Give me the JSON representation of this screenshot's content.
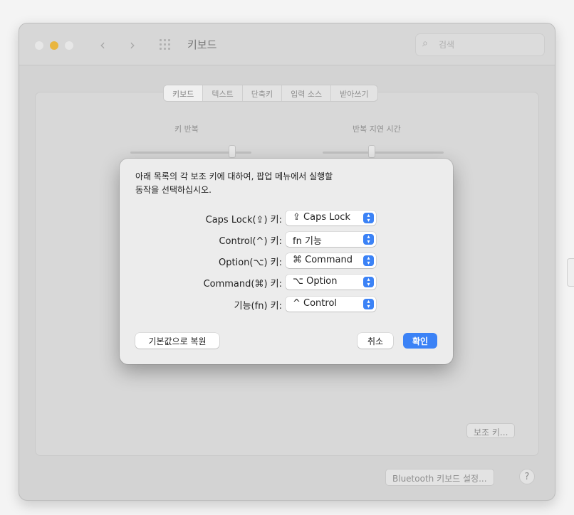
{
  "window": {
    "title": "키보드",
    "search_placeholder": "검색",
    "nav_back": "‹",
    "nav_forward": "›"
  },
  "tabs": [
    {
      "label": "키보드",
      "active": true
    },
    {
      "label": "텍스트",
      "active": false
    },
    {
      "label": "단축키",
      "active": false
    },
    {
      "label": "입력 소스",
      "active": false
    },
    {
      "label": "받아쓰기",
      "active": false
    }
  ],
  "sliders": {
    "key_repeat_label": "키 반복",
    "repeat_delay_label": "반복 지연 시간"
  },
  "panel_buttons": {
    "modifier_keys": "보조 키...",
    "bluetooth_setup": "Bluetooth 키보드 설정...",
    "help": "?"
  },
  "dialog": {
    "description_line1": "아래 목록의 각 보조 키에 대하여, 팝업 메뉴에서 실행할",
    "description_line2": "동작을 선택하십시오.",
    "rows": [
      {
        "label": "Caps Lock(⇪) 키:",
        "value": "⇪ Caps Lock"
      },
      {
        "label": "Control(^) 키:",
        "value": "fn 기능"
      },
      {
        "label": "Option(⌥) 키:",
        "value": "⌘ Command"
      },
      {
        "label": "Command(⌘) 키:",
        "value": "⌥ Option"
      },
      {
        "label": "기능(fn) 키:",
        "value": "^ Control"
      }
    ],
    "restore_defaults": "기본값으로 복원",
    "cancel": "취소",
    "ok": "확인"
  },
  "colors": {
    "accent": "#3b82f6",
    "minimize_light": "#e9b640"
  }
}
